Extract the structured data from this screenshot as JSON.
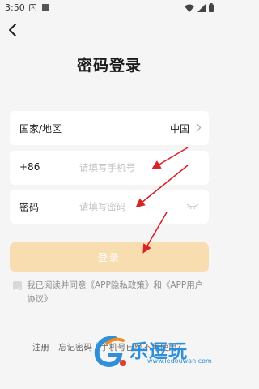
{
  "status_bar": {
    "time": "3:50",
    "notif_letter": "A"
  },
  "header": {
    "title": "密码登录"
  },
  "form": {
    "region": {
      "label": "国家/地区",
      "value": "中国"
    },
    "phone": {
      "prefix": "+86",
      "placeholder": "请填写手机号"
    },
    "password": {
      "label": "密码",
      "placeholder": "请填写密码"
    },
    "login_label": "登录"
  },
  "agreement": {
    "text": "我已阅读并同意《APP隐私政策》和《APP用户协议》"
  },
  "footer": {
    "register": "注册",
    "forgot": "忘记密码",
    "phone_unusable": "手机号已经不再使用?"
  },
  "watermark": {
    "text": "乐逗玩",
    "url": "www.ledouwan.com"
  },
  "colors": {
    "accent_disabled": "#f8ddb1",
    "annotation_arrow": "#d9232a",
    "watermark": "#2f8fd8"
  }
}
